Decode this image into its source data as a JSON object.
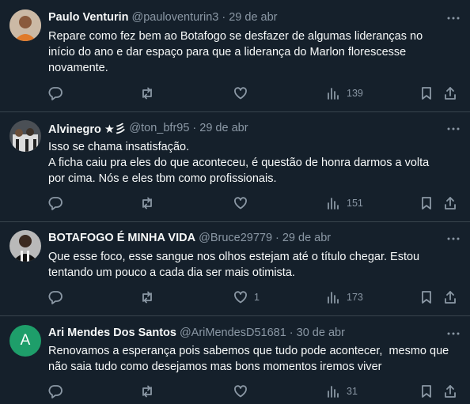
{
  "tweets": [
    {
      "name": "Paulo Venturin",
      "handle": "@pauloventurin3",
      "sep": "·",
      "date": "29 de abr",
      "text": [
        "Repare como fez bem ao Botafogo se desfazer de algumas lideranças no",
        "início do ano e dar espaço para que a liderança do Marlon florescesse",
        "novamente."
      ],
      "reply_count": "",
      "retweet_count": "",
      "like_count": "",
      "views": "139",
      "avatar_icon": "person-photo-avatar"
    },
    {
      "name": "Alvinegro ★彡",
      "handle": "@ton_bfr95",
      "sep": "·",
      "date": "29 de abr",
      "text": [
        "Isso se chama insatisfação.",
        "A ficha caiu pra eles do que aconteceu, é questão de honra darmos a volta",
        "por cima. Nós e eles tbm como profissionais."
      ],
      "reply_count": "",
      "retweet_count": "",
      "like_count": "",
      "views": "151",
      "avatar_icon": "team-photo-avatar"
    },
    {
      "name": "BOTAFOGO É MINHA VIDA",
      "handle": "@Bruce29779",
      "sep": "·",
      "date": "29 de abr",
      "text": [
        "Que esse foco, esse sangue nos olhos estejam até o título chegar. Estou",
        "tentando um pouco a cada dia ser mais otimista."
      ],
      "reply_count": "",
      "retweet_count": "",
      "like_count": "1",
      "views": "173",
      "avatar_icon": "player-photo-avatar"
    },
    {
      "name": "Ari Mendes Dos Santos",
      "handle": "@AriMendesD51681",
      "sep": "·",
      "date": "30 de abr",
      "text": [
        "Renovamos a esperança pois sabemos que tudo pode acontecer,  mesmo que",
        "não saia tudo como desejamos mas bons momentos iremos viver"
      ],
      "reply_count": "",
      "retweet_count": "",
      "like_count": "",
      "views": "31",
      "avatar_letter": "A",
      "avatar_color": "#1e9e6a"
    }
  ],
  "colors": {
    "background": "#15202b",
    "text": "#f7f9f9",
    "muted": "#8b98a5",
    "divider": "#38444d"
  }
}
